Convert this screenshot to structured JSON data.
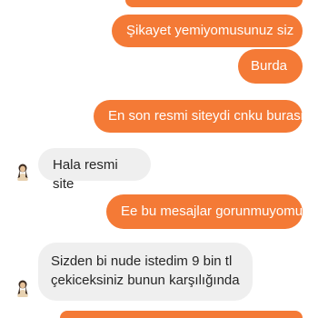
{
  "conversation": {
    "messages": [
      {
        "sender": "me",
        "text": "Şikayet yemiyomusunuz siz"
      },
      {
        "sender": "me",
        "text": "Burda"
      },
      {
        "sender": "me",
        "text": "En son resmi siteydi cnku burasi"
      },
      {
        "sender": "them",
        "text": "Hala resmi site"
      },
      {
        "sender": "me",
        "text": "Ee bu mesajlar gorunmuyomu"
      },
      {
        "sender": "them",
        "text": "Sizden bi nude istedim 9 bin tl çekiceksiniz bunun karşılığında"
      }
    ]
  },
  "colors": {
    "outgoing_bubble": "#f47a36",
    "incoming_bubble": "#efefef",
    "incoming_text": "#262626",
    "outgoing_text": "#ffffff"
  },
  "icons": {
    "avatar": "profile-avatar-icon"
  }
}
